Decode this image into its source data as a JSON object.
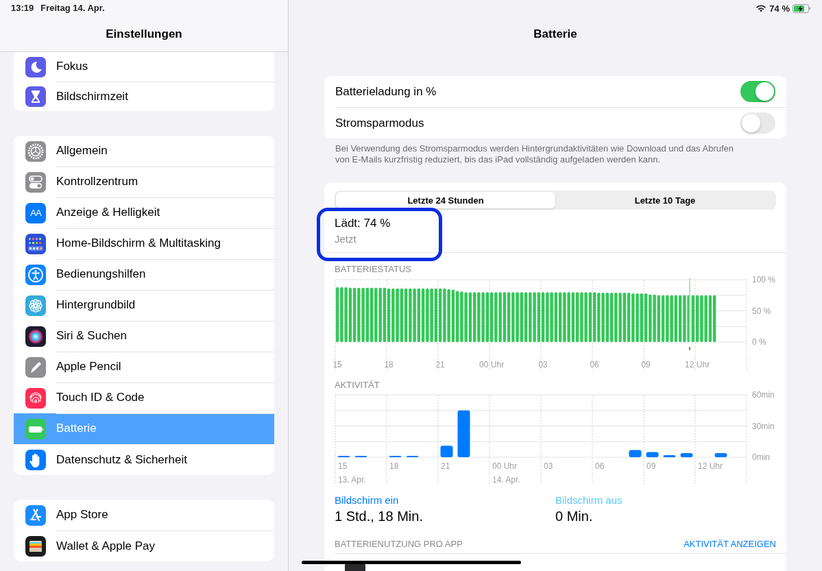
{
  "status_bar": {
    "time": "13:19",
    "date": "Freitag 14. Apr.",
    "battery_text": "74 %"
  },
  "sidebar": {
    "title": "Einstellungen",
    "groups": [
      {
        "items": [
          {
            "label": "Fokus",
            "kind": "moon",
            "color": "#5e5ce6",
            "selected": false
          },
          {
            "label": "Bildschirmzeit",
            "kind": "hourglass",
            "color": "#5e5ce6",
            "selected": false
          }
        ]
      },
      {
        "items": [
          {
            "label": "Allgemein",
            "kind": "gear",
            "color": "#8e8e93",
            "selected": false
          },
          {
            "label": "Kontrollzentrum",
            "kind": "switches",
            "color": "#8e8e93",
            "selected": false
          },
          {
            "label": "Anzeige & Helligkeit",
            "kind": "textsize",
            "icon_text": "AA",
            "color": "#007aff",
            "selected": false
          },
          {
            "label": "Home-Bildschirm & Multitasking",
            "kind": "grid",
            "color": "#2c4fd6",
            "selected": false
          },
          {
            "label": "Bedienungshilfen",
            "kind": "accessibility",
            "color": "#0a84ff",
            "selected": false
          },
          {
            "label": "Hintergrundbild",
            "kind": "flower",
            "color": "#35aadc",
            "selected": false
          },
          {
            "label": "Siri & Suchen",
            "kind": "siri",
            "color": "#1c1c2e",
            "selected": false
          },
          {
            "label": "Apple Pencil",
            "kind": "pencil",
            "color": "#8e8e93",
            "selected": false
          },
          {
            "label": "Touch ID & Code",
            "kind": "fingerprint",
            "color": "#ff2d55",
            "selected": false
          },
          {
            "label": "Batterie",
            "kind": "battery",
            "color": "#34c759",
            "selected": true
          },
          {
            "label": "Datenschutz & Sicherheit",
            "kind": "hand",
            "color": "#007aff",
            "selected": false
          }
        ]
      },
      {
        "items": [
          {
            "label": "App Store",
            "kind": "appstore",
            "color": "#1a8cff",
            "selected": false
          },
          {
            "label": "Wallet & Apple Pay",
            "kind": "wallet",
            "color": "#1c1c1e",
            "selected": false
          }
        ]
      }
    ]
  },
  "detail": {
    "title": "Batterie",
    "toggles": [
      {
        "label": "Batterieladung in %",
        "on": true
      },
      {
        "label": "Stromsparmodus",
        "on": false
      }
    ],
    "footnote": "Bei Verwendung des Stromsparmodus werden Hintergrundaktivitäten wie Download und das Abrufen von E-Mails kurzfristig reduziert, bis das iPad vollständig aufgeladen werden kann.",
    "tabs": [
      {
        "label": "Letzte 24 Stunden",
        "selected": true
      },
      {
        "label": "Letzte 10 Tage",
        "selected": false
      }
    ],
    "charge": {
      "status": "Lädt: 74 %",
      "time": "Jetzt"
    },
    "battery_chart": {
      "chart_data": {
        "type": "bar",
        "title": "BATTERIESTATUS",
        "ylim": [
          0,
          100
        ],
        "categories": [
          "15",
          null,
          null,
          null,
          null,
          null,
          null,
          null,
          null,
          null,
          null,
          null,
          "18",
          null,
          null,
          null,
          null,
          null,
          null,
          null,
          null,
          null,
          null,
          null,
          "21",
          null,
          null,
          null,
          null,
          null,
          null,
          null,
          null,
          null,
          null,
          null,
          "00 Uhr",
          null,
          null,
          null,
          null,
          null,
          null,
          null,
          null,
          null,
          null,
          null,
          "03",
          null,
          null,
          null,
          null,
          null,
          null,
          null,
          null,
          null,
          null,
          null,
          "06",
          null,
          null,
          null,
          null,
          null,
          null,
          null,
          null,
          null,
          null,
          null,
          "09",
          null,
          null,
          null,
          null,
          null,
          null,
          null,
          null,
          null,
          null,
          null,
          "12 Uhr",
          null,
          null,
          null,
          null,
          null,
          null,
          null,
          null,
          null,
          null,
          null
        ],
        "series": [
          {
            "color": "#34c759",
            "values": [
              88,
              88,
              88,
              87,
              87,
              87,
              87,
              87,
              87,
              87,
              87,
              87,
              86,
              86,
              86,
              86,
              86,
              86,
              86,
              86,
              86,
              86,
              86,
              86,
              86,
              86,
              85,
              84,
              82,
              81,
              80,
              80,
              80,
              80,
              80,
              80,
              80,
              80,
              80,
              80,
              80,
              80,
              80,
              80,
              80,
              80,
              80,
              80,
              80,
              80,
              80,
              80,
              80,
              80,
              80,
              80,
              80,
              80,
              80,
              80,
              80,
              79,
              79,
              79,
              79,
              79,
              79,
              79,
              79,
              78,
              78,
              78,
              78,
              76,
              76,
              75,
              75,
              75,
              75,
              75,
              75,
              75,
              75,
              75,
              75,
              75,
              75,
              75,
              75,
              null,
              null,
              null,
              null,
              null,
              null,
              null
            ]
          }
        ],
        "yticks": [
          {
            "value": 0,
            "label": "0 %"
          },
          {
            "value": 50,
            "label": "50 %"
          },
          {
            "value": 100,
            "label": "100 %"
          }
        ]
      }
    },
    "activity_chart": {
      "chart_data": {
        "type": "bar",
        "title": "AKTIVITÄT",
        "ylim": [
          0,
          60
        ],
        "categories": [
          "15",
          null,
          null,
          "18",
          null,
          null,
          "21",
          null,
          null,
          "00 Uhr",
          null,
          null,
          "03",
          null,
          null,
          "06",
          null,
          null,
          "09",
          null,
          null,
          "12 Uhr",
          null,
          null
        ],
        "series": [
          {
            "color": "#007aff",
            "values": [
              1,
              1,
              0,
              1,
              1,
              0,
              11,
              45,
              0,
              0,
              0,
              0,
              0,
              0,
              0,
              0,
              0,
              7,
              5,
              2,
              4,
              0,
              4,
              0
            ]
          }
        ],
        "yticks": [
          {
            "value": 0,
            "label": "0min"
          },
          {
            "value": 30,
            "label": "30min"
          },
          {
            "value": 60,
            "label": "60min"
          }
        ],
        "annotations": [
          "13. Apr.",
          "14. Apr."
        ]
      }
    },
    "screen": [
      {
        "label": "Bildschirm ein",
        "value": "1 Std., 18 Min.",
        "color": "#007aff"
      },
      {
        "label": "Bildschirm aus",
        "value": "0 Min.",
        "color": "#5ac8fa"
      }
    ],
    "usage": {
      "heading": "BATTERIENUTZUNG PRO APP",
      "link": "AKTIVITÄT ANZEIGEN"
    }
  }
}
